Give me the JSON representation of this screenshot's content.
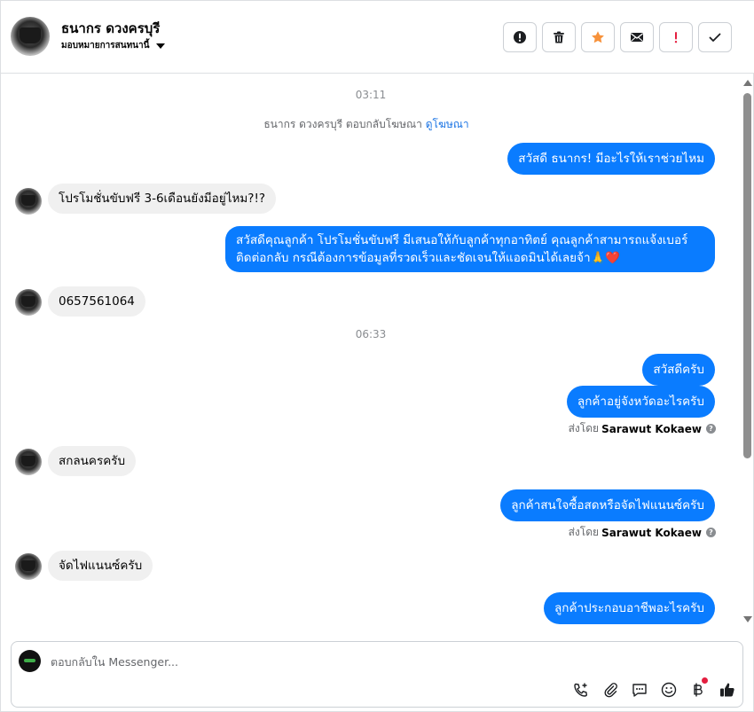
{
  "header": {
    "name": "ธนากร ดวงครบุรี",
    "assign_label": "มอบหมายการสนทนานี้",
    "tools": [
      {
        "name": "mark-spam",
        "icon": "alert-circle-icon"
      },
      {
        "name": "delete",
        "icon": "trash-icon"
      },
      {
        "name": "star",
        "icon": "star-icon"
      },
      {
        "name": "mark-unread",
        "icon": "envelope-icon"
      },
      {
        "name": "follow-up",
        "icon": "exclamation-icon"
      },
      {
        "name": "done",
        "icon": "checkmark-icon"
      }
    ]
  },
  "colors": {
    "outgoing_bubble": "#0a7cff",
    "incoming_bubble": "#f0f0f0",
    "star": "#f7923b",
    "follow_up": "#e41e3f",
    "link": "#1b74e4"
  },
  "messages": {
    "time1": "03:11",
    "ad_note_prefix": "ธนากร ดวงครบุรี ตอบกลับโฆษณา",
    "ad_note_link": "ดูโฆษณา",
    "m1": "สวัสดี ธนากร! มีอะไรให้เราช่วยไหม",
    "m2": "โปรโมชั่นขับฟรี 3-6เดือนยังมีอยู่ไหม?!?",
    "m3": "สวัสดีคุณลูกค้า โปรโมชั่นขับฟรี มีเสนอให้กับลูกค้าทุกอาทิตย์ คุณลูกค้าสามารถแจ้งเบอร์ติดต่อกลับ กรณีต้องการข้อมูลที่รวดเร็วและชัดเจนให้แอดมินได้เลยจ้า🙏❤️",
    "m4": "0657561064",
    "time2": "06:33",
    "m5": "สวัสดีครับ",
    "m6": "ลูกค้าอยู่จังหวัดอะไรครับ",
    "sent_by_prefix": "ส่งโดย",
    "sent_by_name": "Sarawut Kokaew",
    "m7": "สกลนครครับ",
    "m8": "ลูกค้าสนใจซื้อสดหรือจัดไฟแนนซ์ครับ",
    "m9": "จัดไฟแนนซ์ครับ",
    "m10": "ลูกค้าประกอบอาชีพอะไรครับ"
  },
  "composer": {
    "placeholder": "ตอบกลับใน Messenger...",
    "tools": [
      "call-add-icon",
      "paperclip-icon",
      "chat-reply-icon",
      "emoji-icon",
      "baht-icon",
      "thumbs-up-icon"
    ]
  }
}
